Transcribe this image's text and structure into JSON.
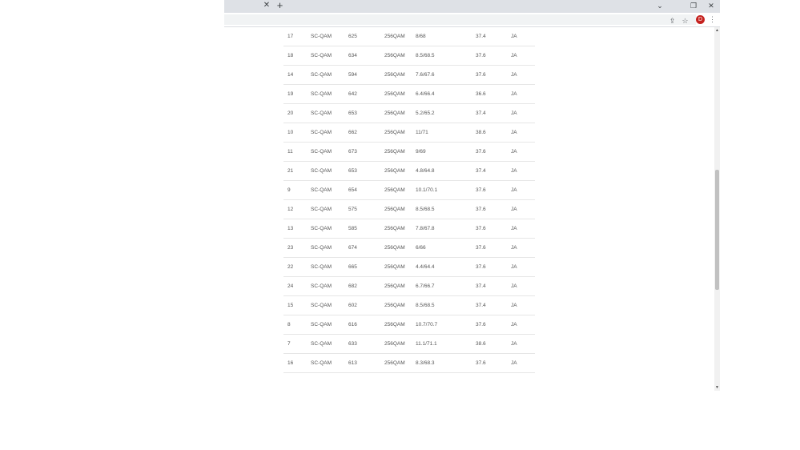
{
  "browser": {
    "tab": {
      "close_glyph": "✕"
    },
    "new_tab_glyph": "+",
    "window_controls": {
      "dropdown": "⌄",
      "restore": "❐",
      "close": "✕"
    },
    "toolbar": {
      "share_glyph": "⇪",
      "star_glyph": "☆",
      "profile_initial": "D",
      "menu_glyph": "⋮"
    },
    "scrollbar": {
      "up_glyph": "▲",
      "down_glyph": "▼"
    }
  },
  "table": {
    "rows": [
      [
        "17",
        "SC-QAM",
        "625",
        "256QAM",
        "8/68",
        "37.4",
        "JA"
      ],
      [
        "18",
        "SC-QAM",
        "634",
        "256QAM",
        "8.5/68.5",
        "37.6",
        "JA"
      ],
      [
        "14",
        "SC-QAM",
        "594",
        "256QAM",
        "7.6/67.6",
        "37.6",
        "JA"
      ],
      [
        "19",
        "SC-QAM",
        "642",
        "256QAM",
        "6.4/66.4",
        "36.6",
        "JA"
      ],
      [
        "20",
        "SC-QAM",
        "653",
        "256QAM",
        "5.2/65.2",
        "37.4",
        "JA"
      ],
      [
        "10",
        "SC-QAM",
        "662",
        "256QAM",
        "11/71",
        "38.6",
        "JA"
      ],
      [
        "11",
        "SC-QAM",
        "673",
        "256QAM",
        "9/69",
        "37.6",
        "JA"
      ],
      [
        "21",
        "SC-QAM",
        "653",
        "256QAM",
        "4.8/64.8",
        "37.4",
        "JA"
      ],
      [
        "9",
        "SC-QAM",
        "654",
        "256QAM",
        "10.1/70.1",
        "37.6",
        "JA"
      ],
      [
        "12",
        "SC-QAM",
        "575",
        "256QAM",
        "8.5/68.5",
        "37.6",
        "JA"
      ],
      [
        "13",
        "SC-QAM",
        "585",
        "256QAM",
        "7.8/67.8",
        "37.6",
        "JA"
      ],
      [
        "23",
        "SC-QAM",
        "674",
        "256QAM",
        "6/66",
        "37.6",
        "JA"
      ],
      [
        "22",
        "SC-QAM",
        "665",
        "256QAM",
        "4.4/64.4",
        "37.6",
        "JA"
      ],
      [
        "24",
        "SC-QAM",
        "682",
        "256QAM",
        "6.7/66.7",
        "37.4",
        "JA"
      ],
      [
        "15",
        "SC-QAM",
        "602",
        "256QAM",
        "8.5/68.5",
        "37.4",
        "JA"
      ],
      [
        "8",
        "SC-QAM",
        "616",
        "256QAM",
        "10.7/70.7",
        "37.6",
        "JA"
      ],
      [
        "7",
        "SC-QAM",
        "633",
        "256QAM",
        "11.1/71.1",
        "38.6",
        "JA"
      ],
      [
        "16",
        "SC-QAM",
        "613",
        "256QAM",
        "8.3/68.3",
        "37.6",
        "JA"
      ]
    ]
  }
}
